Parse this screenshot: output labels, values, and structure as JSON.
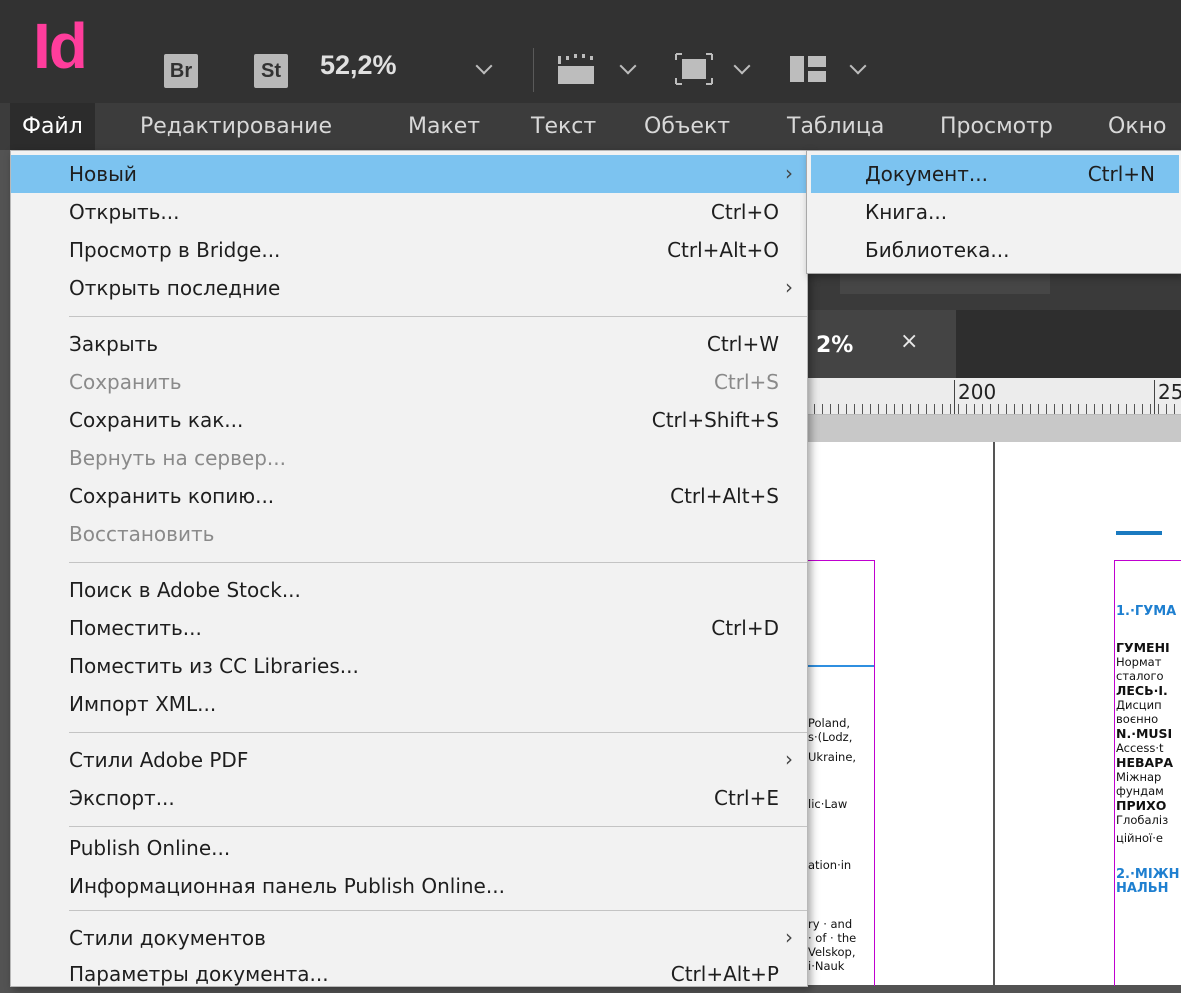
{
  "app": {
    "logo": "Id",
    "bridge_badge": "Br",
    "stock_badge": "St",
    "zoom_level": "52,2%"
  },
  "menubar": {
    "items": [
      "Файл",
      "Редактирование",
      "Макет",
      "Текст",
      "Объект",
      "Таблица",
      "Просмотр",
      "Окно"
    ]
  },
  "file_menu": {
    "items": [
      {
        "label": "Новый",
        "shortcut": "",
        "submenu": "›"
      },
      {
        "label": "Открыть...",
        "shortcut": "Ctrl+O"
      },
      {
        "label": "Просмотр в Bridge...",
        "shortcut": "Ctrl+Alt+O"
      },
      {
        "label": "Открыть последние",
        "shortcut": "",
        "submenu": "›"
      },
      {
        "label": "Закрыть",
        "shortcut": "Ctrl+W"
      },
      {
        "label": "Сохранить",
        "shortcut": "Ctrl+S",
        "disabled": true
      },
      {
        "label": "Сохранить как...",
        "shortcut": "Ctrl+Shift+S"
      },
      {
        "label": "Вернуть на сервер...",
        "shortcut": "",
        "disabled": true
      },
      {
        "label": "Сохранить копию...",
        "shortcut": "Ctrl+Alt+S"
      },
      {
        "label": "Восстановить",
        "shortcut": "",
        "disabled": true
      },
      {
        "label": "Поиск в Adobe Stock...",
        "shortcut": ""
      },
      {
        "label": "Поместить...",
        "shortcut": "Ctrl+D"
      },
      {
        "label": "Поместить из CC Libraries...",
        "shortcut": ""
      },
      {
        "label": "Импорт XML...",
        "shortcut": ""
      },
      {
        "label": "Стили Adobe PDF",
        "shortcut": "",
        "submenu": "›"
      },
      {
        "label": "Экспорт...",
        "shortcut": "Ctrl+E"
      },
      {
        "label": "Publish Online...",
        "shortcut": ""
      },
      {
        "label": "Информационная панель Publish Online...",
        "shortcut": ""
      },
      {
        "label": "Стили документов",
        "shortcut": "",
        "submenu": "›"
      },
      {
        "label": "Параметры документа...",
        "shortcut": "Ctrl+Alt+P"
      }
    ]
  },
  "new_submenu": {
    "items": [
      {
        "label": "Документ...",
        "shortcut": "Ctrl+N"
      },
      {
        "label": "Книга...",
        "shortcut": ""
      },
      {
        "label": "Библиотека...",
        "shortcut": ""
      }
    ]
  },
  "document": {
    "tab_zoom": "2%",
    "tab_close": "×",
    "ruler_labels": [
      "200",
      "25"
    ],
    "left_page_fragments": [
      "Poland,",
      "s·(Lodz,",
      "Ukraine,",
      "lic·Law",
      "ation·in",
      "ry · and",
      "· of · the",
      "Velskop,",
      "i·Nauk"
    ],
    "right_page_fragments": [
      "1.·ГУМА",
      "ГУМЕНІ",
      "Нормат",
      "сталого",
      "ЛЕСЬ·І.",
      "Дисцип",
      "воєнно",
      "N.·MUSI",
      "Access·t",
      "НЕВАРА",
      "Міжнар",
      "фундам",
      "ПРИХО",
      "Глобаліз",
      "ційної·е",
      "2.·МІЖН",
      "НАЛЬН"
    ]
  },
  "colors": {
    "logo": "#ff3d9c",
    "menu_highlight": "#7cc3f0",
    "frame_guides": "#c000d0",
    "heading_blue": "#1e7fd0"
  }
}
